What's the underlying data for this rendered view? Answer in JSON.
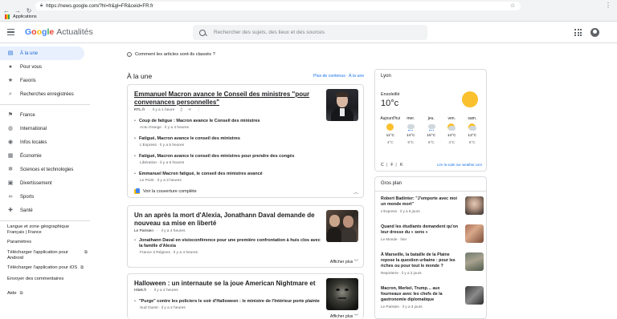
{
  "browser": {
    "url": "https://news.google.com/?hl=fr&gl=FR&ceid=FR:fr",
    "bookmark": "Applications"
  },
  "header": {
    "logo_google": "Google",
    "logo_product": "Actualités",
    "search_placeholder": "Rechercher des sujets, des lieux et des sources"
  },
  "sidebar": {
    "items": [
      {
        "label": "À la une",
        "icon": "top-stories-icon"
      },
      {
        "label": "Pour vous",
        "icon": "person-icon"
      },
      {
        "label": "Favoris",
        "icon": "star-icon"
      },
      {
        "label": "Recherches enregistrées",
        "icon": "search-icon"
      },
      {
        "label": "France",
        "icon": "flag-icon"
      },
      {
        "label": "International",
        "icon": "globe-icon"
      },
      {
        "label": "Infos locales",
        "icon": "location-icon"
      },
      {
        "label": "Économie",
        "icon": "business-icon"
      },
      {
        "label": "Sciences et technologies",
        "icon": "science-icon"
      },
      {
        "label": "Divertissement",
        "icon": "film-icon"
      },
      {
        "label": "Sports",
        "icon": "bike-icon"
      },
      {
        "label": "Santé",
        "icon": "health-icon"
      }
    ],
    "lang_title": "Langue et zone géographique",
    "lang_value": "Français | France",
    "settings": "Paramètres",
    "android": "Télécharger l'application pour Android",
    "ios": "Télécharger l'application pour iOS",
    "feedback": "Envoyer des commentaires",
    "help": "Aide"
  },
  "main": {
    "classed_info": "Comment les articles sont-ils classés ?",
    "section_title": "À la une",
    "more_link": "Plus de contenus : À la une",
    "card1": {
      "headline": "Emmanuel Macron avance le Conseil des ministres \"pour convenances personnelles\"",
      "source": "RTL.fr",
      "time": "il y a 1 heure",
      "subs": [
        {
          "title": "Coup de fatigue : Macron avance le Conseil des ministres",
          "source": "Actu Orange",
          "time": "il y a 4 heures"
        },
        {
          "title": "Fatigué, Macron avance le conseil des ministres",
          "source": "L'Express",
          "time": "il y a 5 heures"
        },
        {
          "title": "Fatigué, Macron avance le conseil des ministres pour prendre des congés",
          "source": "Libération",
          "time": "il y a 5 heures"
        },
        {
          "title": "Emmanuel Macron fatigué, le conseil des ministres avancé",
          "source": "Le Point",
          "time": "il y a 3 heures"
        }
      ],
      "full_coverage": "Voir la couverture complète"
    },
    "card2": {
      "headline": "Un an après la mort d'Alexia, Jonathann Daval demande de nouveau sa mise en liberté",
      "source": "Le Parisien",
      "time": "il y a 4 heures",
      "subs": [
        {
          "title": "Jonathann Daval en visioconférence pour une première confrontation à huis clos avec la famille d'Alexia",
          "source": "France 3 Régions",
          "time": "il y a 4 heures"
        }
      ],
      "show_more": "Afficher plus"
    },
    "card3": {
      "headline": "Halloween : un internaute se la joue American Nightmare et",
      "source": "Hitek.fr",
      "time": "il y a 2 heures",
      "subs": [
        {
          "title": "\"Purge\" contre les policiers le soir d'Halloween : le ministre de l'Intérieur porte plainte",
          "source": "Sud Ouest",
          "time": "il y a 2 heures"
        }
      ],
      "show_more": "Afficher plus"
    }
  },
  "weather": {
    "city": "Lyon",
    "condition": "Ensoleillé",
    "temperature": "10°c",
    "days": [
      {
        "day": "Aujourd'hui",
        "hi": "11°C",
        "lo": "4°C",
        "icon": "sun"
      },
      {
        "day": "mer.",
        "hi": "14°C",
        "lo": "9°C",
        "icon": "rain"
      },
      {
        "day": "jeu.",
        "hi": "15°C",
        "lo": "6°C",
        "icon": "rain"
      },
      {
        "day": "ven.",
        "hi": "14°C",
        "lo": "4°C",
        "icon": "partly"
      },
      {
        "day": "sam.",
        "hi": "13°C",
        "lo": "6°C",
        "icon": "partly"
      }
    ],
    "unit_c": "C",
    "unit_f": "F",
    "unit_k": "K",
    "more": "Lire la suite sur weather.com"
  },
  "gros_plan": {
    "title": "Gros plan",
    "items": [
      {
        "title": "Robert Badinter: \"J'emporte avec moi un monde mort\"",
        "source": "L'Express",
        "time": "il y a 6 jours"
      },
      {
        "title": "Quand les étudiants demandent qu'on leur dresse du « sens »",
        "source": "Le Monde",
        "time": "hier"
      },
      {
        "title": "À Marseille, la bataille de la Plaine repose la question urbaine : pour les riches ou pour tout le monde ?",
        "source": "Reporterre",
        "time": "il y a 3 jours"
      },
      {
        "title": "Macron, Merkel, Trump… aux fourneaux avec les chefs de la gastronomie diplomatique",
        "source": "Le Parisien",
        "time": "il y a 3 jours"
      }
    ]
  }
}
